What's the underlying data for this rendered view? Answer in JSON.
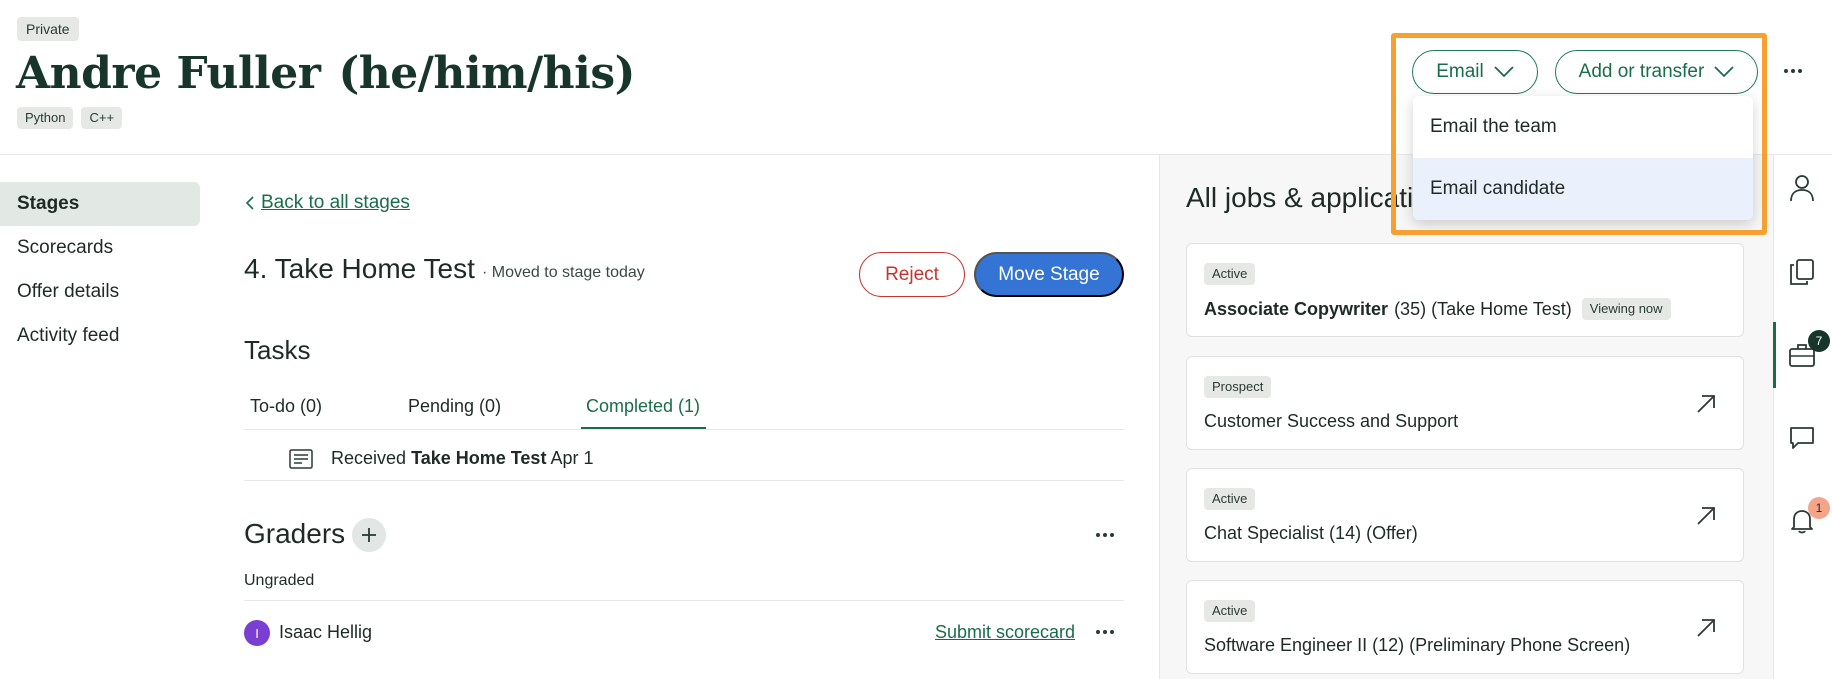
{
  "header": {
    "privacy_badge": "Private",
    "candidate_name": "Andre Fuller",
    "pronouns": "(he/him/his)",
    "tags": [
      "Python",
      "C++"
    ],
    "email_button": "Email",
    "transfer_button": "Add or transfer",
    "email_menu": [
      "Email the team",
      "Email candidate"
    ]
  },
  "nav": {
    "items": [
      "Stages",
      "Scorecards",
      "Offer details",
      "Activity feed"
    ],
    "active": "Stages"
  },
  "main": {
    "back_link": "Back to all stages",
    "stage_title": "4. Take Home Test",
    "stage_subtitle": "·  Moved to stage today",
    "reject_button": "Reject",
    "move_button": "Move Stage",
    "tasks_title": "Tasks",
    "task_tabs": [
      "To-do (0)",
      "Pending (0)",
      "Completed (1)"
    ],
    "active_tab": "Completed (1)",
    "task_row": {
      "prefix": "Received",
      "item": "Take Home Test",
      "date": "Apr 1"
    },
    "graders_title": "Graders",
    "ungraded_label": "Ungraded",
    "grader": {
      "initial": "I",
      "name": "Isaac Hellig",
      "action": "Submit scorecard"
    }
  },
  "right_panel": {
    "title": "All jobs & applications",
    "jobs": [
      {
        "status": "Active",
        "title": "Associate Copywriter",
        "detail": "(35) (Take Home Test)",
        "viewing": "Viewing now"
      },
      {
        "status": "Prospect",
        "title": "Customer Success and Support"
      },
      {
        "status": "Active",
        "title": "Chat Specialist (14) (Offer)"
      },
      {
        "status": "Active",
        "title": "Software Engineer II (12) (Preliminary Phone Screen)"
      }
    ]
  },
  "rail": {
    "jobs_count": "7",
    "notifications_count": "1"
  },
  "colors": {
    "brand_green": "#1a6d4b",
    "primary_blue": "#3474d4",
    "danger_red": "#c7342f",
    "highlight_orange": "#f5a031"
  }
}
